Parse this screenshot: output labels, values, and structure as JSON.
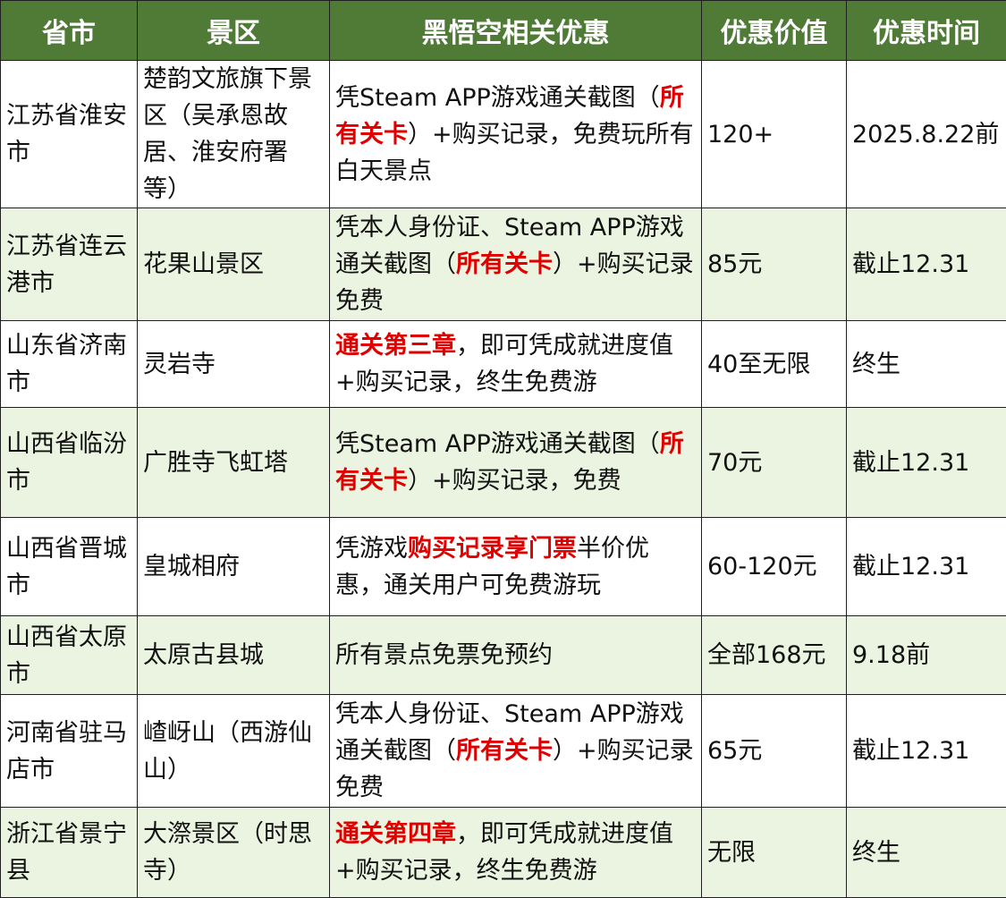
{
  "colors": {
    "header_bg": "#4f7b37",
    "header_text": "#ffffff",
    "stripe_bg": "#eaf4e1",
    "highlight": "#e00000"
  },
  "headers": [
    "省市",
    "景区",
    "黑悟空相关优惠",
    "优惠价值",
    "优惠时间"
  ],
  "rows": [
    {
      "province": "江苏省淮安市",
      "scenic": "楚韵文旅旗下景区（吴承恩故居、淮安府署等）",
      "offer": [
        {
          "text": "凭Steam APP游戏通关截图（",
          "hl": false
        },
        {
          "text": "所有关卡",
          "hl": true
        },
        {
          "text": "）+购买记录，免费玩所有白天景点",
          "hl": false
        }
      ],
      "value": "120+",
      "time": "2025.8.22前"
    },
    {
      "province": "江苏省连云港市",
      "scenic": "花果山景区",
      "offer": [
        {
          "text": "凭本人身份证、Steam APP游戏通关截图（",
          "hl": false
        },
        {
          "text": "所有关卡",
          "hl": true
        },
        {
          "text": "）+购买记录免费",
          "hl": false
        }
      ],
      "value": "85元",
      "time": "截止12.31"
    },
    {
      "province": "山东省济南市",
      "scenic": "灵岩寺",
      "offer": [
        {
          "text": "通关第三章",
          "hl": true
        },
        {
          "text": "，即可凭成就进度值+购买记录，终生免费游",
          "hl": false
        }
      ],
      "value": "40至无限",
      "time": "终生"
    },
    {
      "province": "山西省临汾市",
      "scenic": "广胜寺飞虹塔",
      "offer": [
        {
          "text": "凭Steam APP游戏通关截图（",
          "hl": false
        },
        {
          "text": "所有关卡",
          "hl": true
        },
        {
          "text": "）+购买记录，免费",
          "hl": false
        }
      ],
      "value": "70元",
      "time": "截止12.31"
    },
    {
      "province": "山西省晋城市",
      "scenic": "皇城相府",
      "offer": [
        {
          "text": "凭游戏",
          "hl": false
        },
        {
          "text": "购买记录享门票",
          "hl": true
        },
        {
          "text": "半价优惠，通关用户可免费游玩",
          "hl": false
        }
      ],
      "value": "60-120元",
      "time": "截止12.31"
    },
    {
      "province": "山西省太原市",
      "scenic": "太原古县城",
      "offer": [
        {
          "text": "所有景点免票免预约",
          "hl": false
        }
      ],
      "value": "全部168元",
      "time": "9.18前"
    },
    {
      "province": "河南省驻马店市",
      "scenic": "嵖岈山（西游仙山）",
      "offer": [
        {
          "text": "凭本人身份证、Steam APP游戏通关截图（",
          "hl": false
        },
        {
          "text": "所有关卡",
          "hl": true
        },
        {
          "text": "）+购买记录免费",
          "hl": false
        }
      ],
      "value": "65元",
      "time": "截止12.31"
    },
    {
      "province": "浙江省景宁县",
      "scenic": "大漈景区（时思寺）",
      "offer": [
        {
          "text": "通关第四章",
          "hl": true
        },
        {
          "text": "，即可凭成就进度值+购买记录，终生免费游",
          "hl": false
        }
      ],
      "value": "无限",
      "time": "终生"
    }
  ]
}
